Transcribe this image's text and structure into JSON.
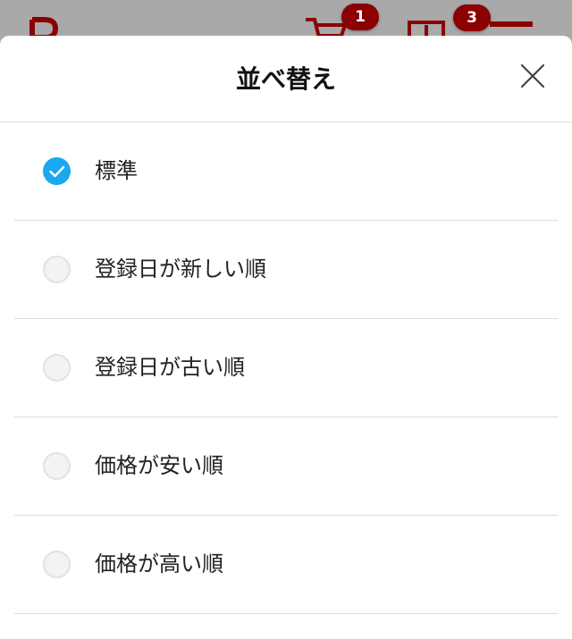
{
  "background": {
    "cart_badge": "1",
    "other_badge": "3",
    "badge_color": "#8b0000",
    "icon_color": "#8b0000",
    "icons": [
      "logo-icon",
      "cart-icon",
      "square-icon",
      "menu-icon"
    ]
  },
  "sheet": {
    "title": "並べ替え",
    "close_icon": "close-icon",
    "accent_color": "#1aa9f0",
    "options": [
      {
        "label": "標準",
        "selected": true
      },
      {
        "label": "登録日が新しい順",
        "selected": false
      },
      {
        "label": "登録日が古い順",
        "selected": false
      },
      {
        "label": "価格が安い順",
        "selected": false
      },
      {
        "label": "価格が高い順",
        "selected": false
      }
    ]
  }
}
